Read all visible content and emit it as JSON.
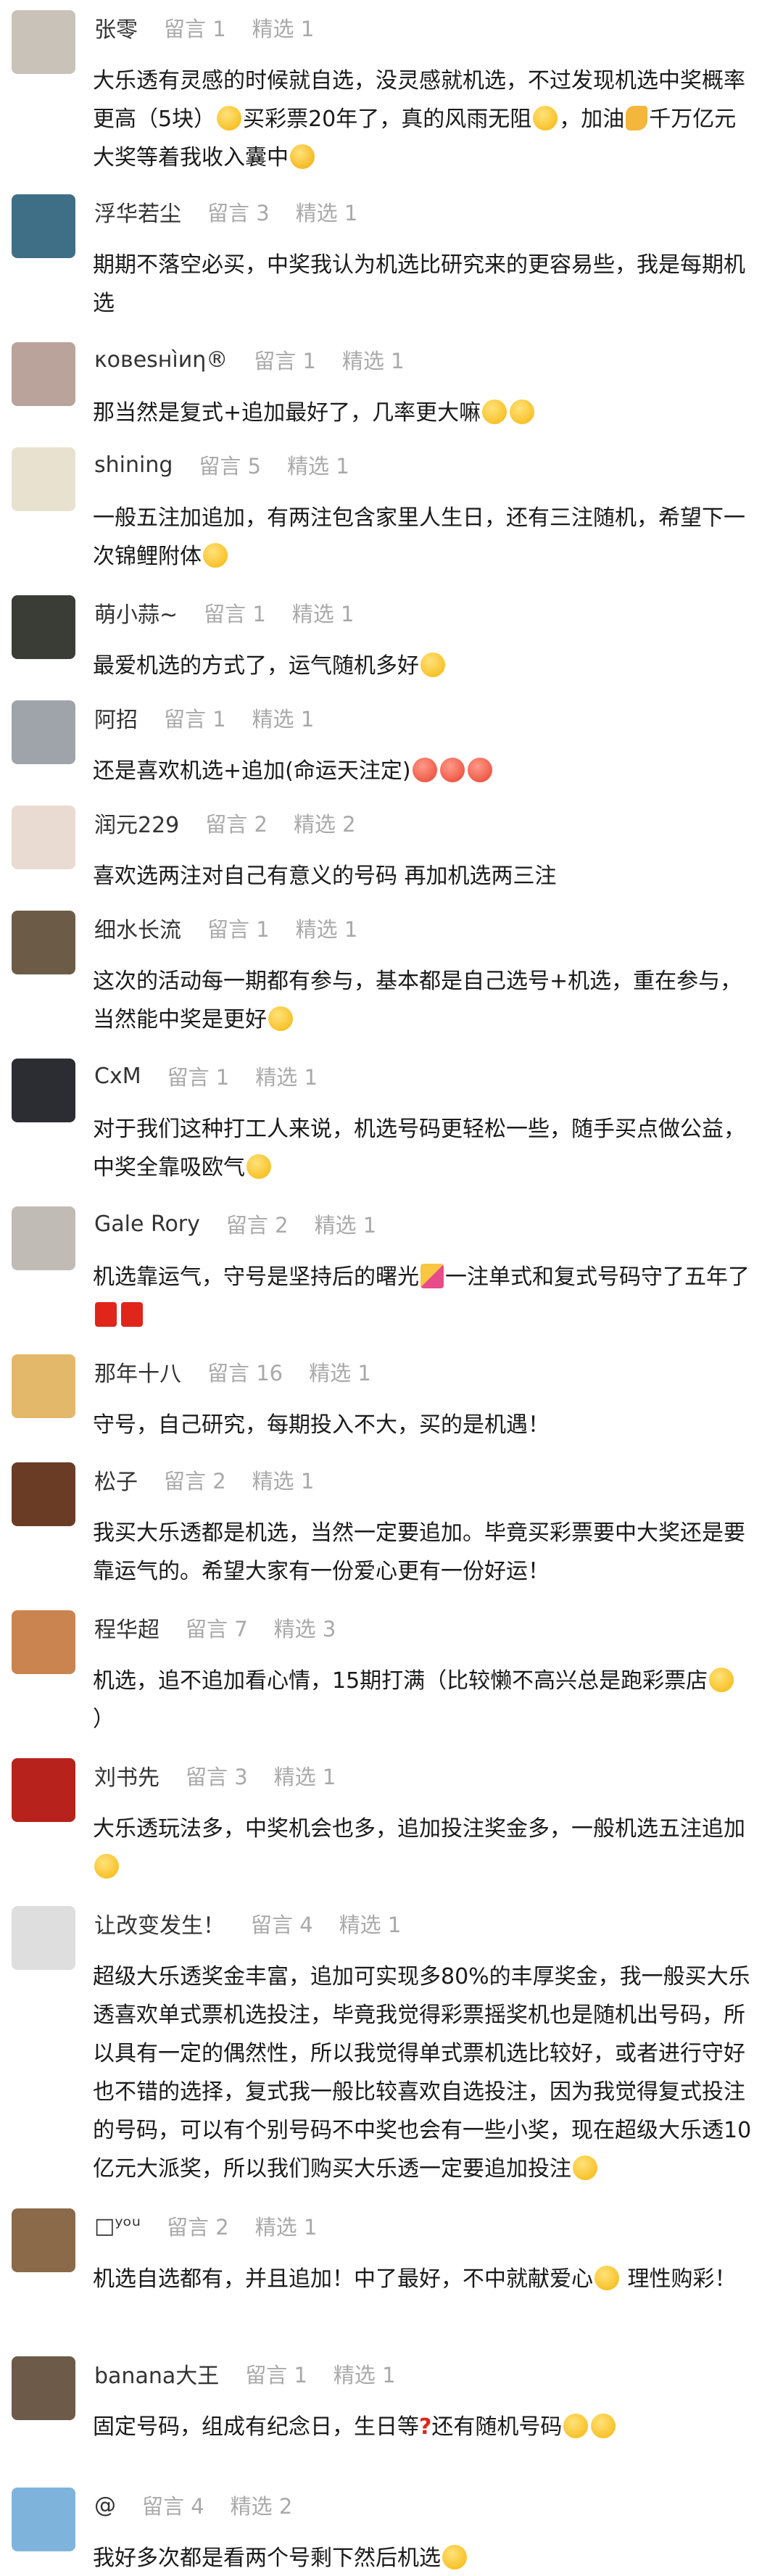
{
  "labels": {
    "comments": "留言",
    "featured": "精选"
  },
  "comments": [
    {
      "name": "张零",
      "comments": "1",
      "featured": "1",
      "text": [
        "大乐透有灵感的时候就自选，没灵感就机选，不过发现机选中奖概率更高（5块）",
        "[grin]",
        "买彩票20年了，真的风雨无阻",
        "[emoji]",
        "，加油",
        "[muscle]",
        "千万亿元大奖等着我收入囊中",
        "[cool]"
      ]
    },
    {
      "name": "浮华若尘",
      "comments": "3",
      "featured": "1",
      "text": [
        "期期不落空必买，中奖我认为机选比研究来的更容易些，我是每期机选"
      ]
    },
    {
      "name": "κοвеѕнìиη®",
      "comments": "1",
      "featured": "1",
      "text": [
        "那当然是复式+追加最好了，几率更大嘛",
        "[grin]",
        "[grin]"
      ]
    },
    {
      "name": "shining",
      "comments": "5",
      "featured": "1",
      "text": [
        "一般五注加追加，有两注包含家里人生日，还有三注随机，希望下一次锦鲤附体",
        "[grin]"
      ]
    },
    {
      "name": "萌小蒜~",
      "comments": "1",
      "featured": "1",
      "text": [
        "最爱机选的方式了，运气随机多好",
        "[grin]"
      ]
    },
    {
      "name": "阿招",
      "comments": "1",
      "featured": "1",
      "text": [
        "还是喜欢机选+追加(命运天注定)",
        "[tongue]",
        "[tongue]",
        "[tongue]"
      ]
    },
    {
      "name": "润元229",
      "comments": "2",
      "featured": "2",
      "text": [
        "喜欢选两注对自己有意义的号码 再加机选两三注"
      ]
    },
    {
      "name": "细水长流",
      "comments": "1",
      "featured": "1",
      "text": [
        "这次的活动每一期都有参与，基本都是自己选号+机选，重在参与，当然能中奖是更好",
        "[emoji]"
      ]
    },
    {
      "name": "CxM",
      "comments": "1",
      "featured": "1",
      "text": [
        "对于我们这种打工人来说，机选号码更轻松一些，随手买点做公益，中奖全靠吸欧气",
        "[emoji]"
      ]
    },
    {
      "name": "Gale Rory",
      "comments": "2",
      "featured": "1",
      "text": [
        "机选靠运气，守号是坚持后的曙光",
        "[party]",
        "一注单式和复式号码守了五年了",
        "[flag]",
        "[flag]"
      ]
    },
    {
      "name": "那年十八",
      "comments": "16",
      "featured": "1",
      "text": [
        "守号，自己研究，每期投入不大，买的是机遇！"
      ]
    },
    {
      "name": "松子",
      "comments": "2",
      "featured": "1",
      "text": [
        "我买大乐透都是机选，当然一定要追加。毕竟买彩票要中大奖还是要靠运气的。希望大家有一份爱心更有一份好运！"
      ]
    },
    {
      "name": "程华超",
      "comments": "7",
      "featured": "3",
      "text": [
        "机选，追不追加看心情，15期打满（比较懒不高兴总是跑彩票店",
        "[emoji]",
        "）"
      ]
    },
    {
      "name": "刘书先",
      "comments": "3",
      "featured": "1",
      "text": [
        "大乐透玩法多，中奖机会也多，追加投注奖金多，一般机选五注追加",
        "[emoji]"
      ]
    },
    {
      "name": "让改变发生！",
      "comments": "4",
      "featured": "1",
      "text": [
        "超级大乐透奖金丰富，追加可实现多80%的丰厚奖金，我一般买大乐透喜欢单式票机选投注，毕竟我觉得彩票摇奖机也是随机出号码，所以具有一定的偶然性，所以我觉得单式票机选比较好，或者进行守好也不错的选择，复式我一般比较喜欢自选投注，因为我觉得复式投注的号码，可以有个别号码不中奖也会有一些小奖，现在超级大乐透10亿元大派奖，所以我们购买大乐透一定要追加投注",
        "[grin]"
      ]
    },
    {
      "name": "□ʸᵒᵘ",
      "comments": "2",
      "featured": "1",
      "text": [
        "机选自选都有，并且追加！中了最好，不中就献爱心",
        "[emoji]",
        " 理性购彩！"
      ]
    },
    {
      "name": "banana大王",
      "comments": "1",
      "featured": "1",
      "text": [
        "固定号码，组成有纪念日，生日等",
        "[qmark]",
        "还有随机号码",
        "[emoji]",
        "[emoji]"
      ]
    },
    {
      "name": "@",
      "comments": "4",
      "featured": "2",
      "text": [
        "我好多次都是看两个号剩下然后机选",
        "[grin]"
      ]
    }
  ],
  "avatars": [
    "#c9c2b8",
    "#3f6f86",
    "#b9a39a",
    "#e9e1cf",
    "#3a3d36",
    "#9fa4ab",
    "#eadbd2",
    "#6c5c47",
    "#2c2c33",
    "#c0bbb5",
    "#e3b86a",
    "#6a3c25",
    "#c98450",
    "#b8221c",
    "#dedede",
    "#8b6a4a",
    "#6e5a48",
    "#7eb4dc"
  ]
}
